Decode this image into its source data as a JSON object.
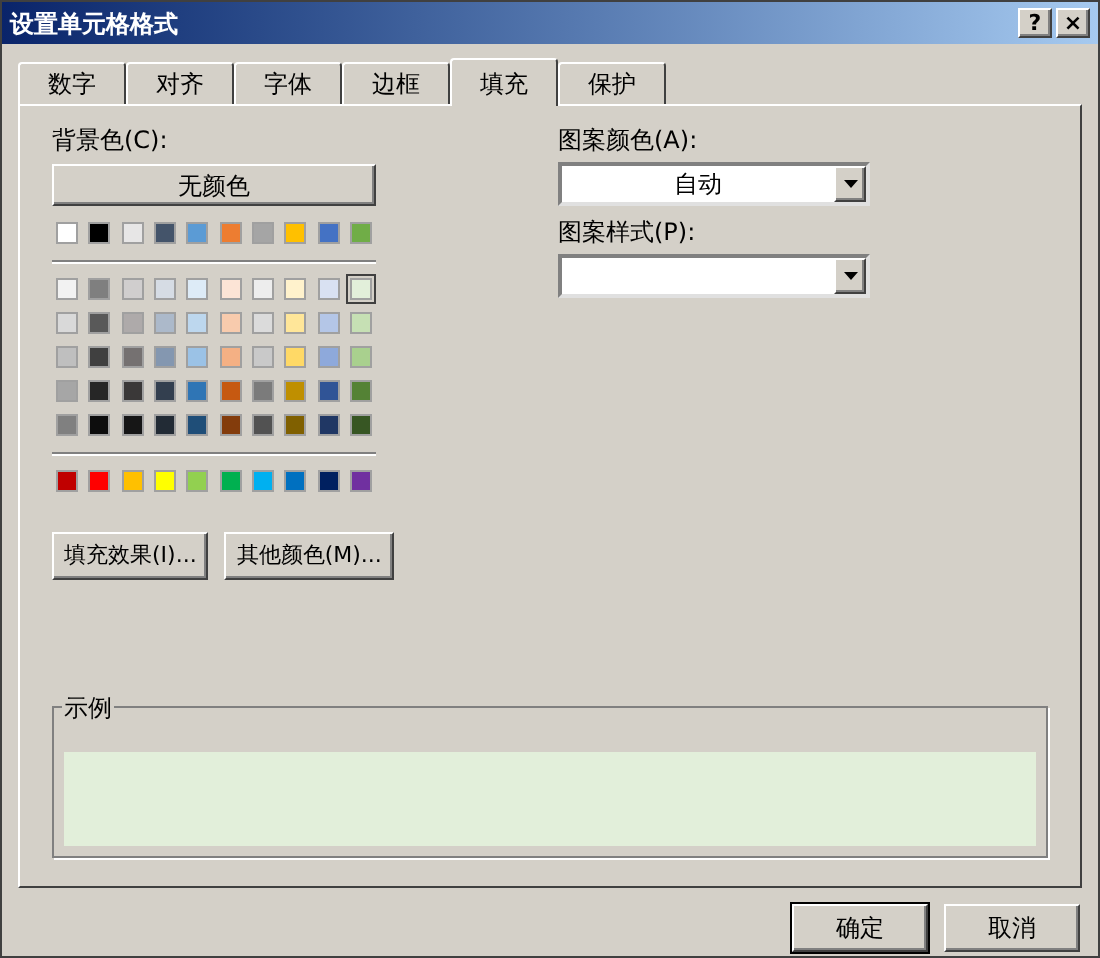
{
  "window": {
    "title": "设置单元格格式",
    "buttons": [
      "?",
      "×"
    ]
  },
  "tabs": [
    {
      "label": "数字",
      "selected": false
    },
    {
      "label": "对齐",
      "selected": false
    },
    {
      "label": "字体",
      "selected": false
    },
    {
      "label": "边框",
      "selected": false
    },
    {
      "label": "填充",
      "selected": true
    },
    {
      "label": "保护",
      "selected": false
    }
  ],
  "background": {
    "label": "背景色(C):",
    "no_color_button": "无颜色",
    "top_row": [
      {
        "color": "#ffffff",
        "selected": false
      },
      {
        "color": "#000000",
        "selected": false
      },
      {
        "color": "#e7e6e6",
        "selected": false
      },
      {
        "color": "#44546a",
        "selected": false
      },
      {
        "color": "#5b9bd5",
        "selected": false
      },
      {
        "color": "#ed7d31",
        "selected": false
      },
      {
        "color": "#a5a5a5",
        "selected": false
      },
      {
        "color": "#ffc000",
        "selected": false
      },
      {
        "color": "#4472c4",
        "selected": false
      },
      {
        "color": "#70ad47",
        "selected": false
      }
    ],
    "shade_rows": [
      [
        {
          "color": "#f2f2f2",
          "selected": false
        },
        {
          "color": "#7f7f7f",
          "selected": false
        },
        {
          "color": "#d0cece",
          "selected": false
        },
        {
          "color": "#d6dce4",
          "selected": false
        },
        {
          "color": "#ddebf7",
          "selected": false
        },
        {
          "color": "#fce4d6",
          "selected": false
        },
        {
          "color": "#ededed",
          "selected": false
        },
        {
          "color": "#fff2cc",
          "selected": false
        },
        {
          "color": "#d9e1f2",
          "selected": false
        },
        {
          "color": "#e2efda",
          "selected": true
        }
      ],
      [
        {
          "color": "#d9d9d9",
          "selected": false
        },
        {
          "color": "#595959",
          "selected": false
        },
        {
          "color": "#aeaaaa",
          "selected": false
        },
        {
          "color": "#acb9ca",
          "selected": false
        },
        {
          "color": "#bdd7ee",
          "selected": false
        },
        {
          "color": "#f8cbad",
          "selected": false
        },
        {
          "color": "#dbdbdb",
          "selected": false
        },
        {
          "color": "#ffe699",
          "selected": false
        },
        {
          "color": "#b4c6e7",
          "selected": false
        },
        {
          "color": "#c6e0b4",
          "selected": false
        }
      ],
      [
        {
          "color": "#bfbfbf",
          "selected": false
        },
        {
          "color": "#404040",
          "selected": false
        },
        {
          "color": "#757171",
          "selected": false
        },
        {
          "color": "#8497b0",
          "selected": false
        },
        {
          "color": "#9bc2e6",
          "selected": false
        },
        {
          "color": "#f4b084",
          "selected": false
        },
        {
          "color": "#c9c9c9",
          "selected": false
        },
        {
          "color": "#ffd966",
          "selected": false
        },
        {
          "color": "#8ea9db",
          "selected": false
        },
        {
          "color": "#a9d08e",
          "selected": false
        }
      ],
      [
        {
          "color": "#a6a6a6",
          "selected": false
        },
        {
          "color": "#262626",
          "selected": false
        },
        {
          "color": "#3a3838",
          "selected": false
        },
        {
          "color": "#333f4f",
          "selected": false
        },
        {
          "color": "#2f75b5",
          "selected": false
        },
        {
          "color": "#c65911",
          "selected": false
        },
        {
          "color": "#7b7b7b",
          "selected": false
        },
        {
          "color": "#bf8f00",
          "selected": false
        },
        {
          "color": "#305496",
          "selected": false
        },
        {
          "color": "#548235",
          "selected": false
        }
      ],
      [
        {
          "color": "#808080",
          "selected": false
        },
        {
          "color": "#0d0d0d",
          "selected": false
        },
        {
          "color": "#161616",
          "selected": false
        },
        {
          "color": "#222b35",
          "selected": false
        },
        {
          "color": "#1f4e78",
          "selected": false
        },
        {
          "color": "#833c0c",
          "selected": false
        },
        {
          "color": "#525252",
          "selected": false
        },
        {
          "color": "#806000",
          "selected": false
        },
        {
          "color": "#203764",
          "selected": false
        },
        {
          "color": "#375623",
          "selected": false
        }
      ]
    ],
    "standard_row": [
      {
        "color": "#c00000",
        "selected": false
      },
      {
        "color": "#ff0000",
        "selected": false
      },
      {
        "color": "#ffc000",
        "selected": false
      },
      {
        "color": "#ffff00",
        "selected": false
      },
      {
        "color": "#92d050",
        "selected": false
      },
      {
        "color": "#00b050",
        "selected": false
      },
      {
        "color": "#00b0f0",
        "selected": false
      },
      {
        "color": "#0070c0",
        "selected": false
      },
      {
        "color": "#002060",
        "selected": false
      },
      {
        "color": "#7030a0",
        "selected": false
      }
    ],
    "buttons": [
      "填充效果(I)...",
      "其他颜色(M)..."
    ]
  },
  "pattern_color": {
    "label": "图案颜色(A):",
    "value": "自动"
  },
  "pattern_style": {
    "label": "图案样式(P):"
  },
  "sample": {
    "label": "示例",
    "color": "#e2efda"
  },
  "footer_buttons": [
    "确定",
    "取消"
  ]
}
